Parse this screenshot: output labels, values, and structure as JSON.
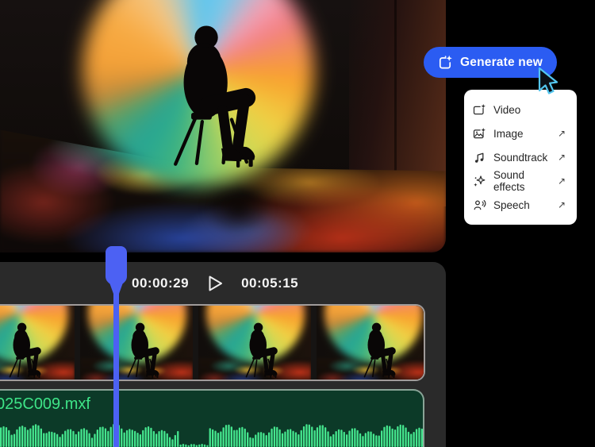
{
  "page": {
    "background": "#000000"
  },
  "generate_menu": {
    "button_label": "Generate new",
    "button_color": "#2b5cf2",
    "external_arrow": "↗",
    "items": [
      {
        "label": "Video",
        "icon": "video-generate-icon",
        "external": false
      },
      {
        "label": "Image",
        "icon": "image-generate-icon",
        "external": true
      },
      {
        "label": "Soundtrack",
        "icon": "soundtrack-icon",
        "external": true
      },
      {
        "label": "Sound effects",
        "icon": "sound-effects-icon",
        "external": true
      },
      {
        "label": "Speech",
        "icon": "speech-icon",
        "external": true
      }
    ]
  },
  "preview": {
    "alt": "Silhouette of a person seated on a chair in front of a large rainbow gradient circle, reflective floor"
  },
  "timeline": {
    "current_time": "00:00:29",
    "total_time": "00:05:15",
    "video_clip": {
      "thumbnail_frames": 4
    },
    "audio_clip": {
      "filename": "025C009.mxf",
      "waveform_color": "#45e68e",
      "background": "#0c3a28",
      "text_color": "#3ee487"
    },
    "playhead_color": "#4c61f3",
    "panel_color": "#2a2a2a"
  }
}
